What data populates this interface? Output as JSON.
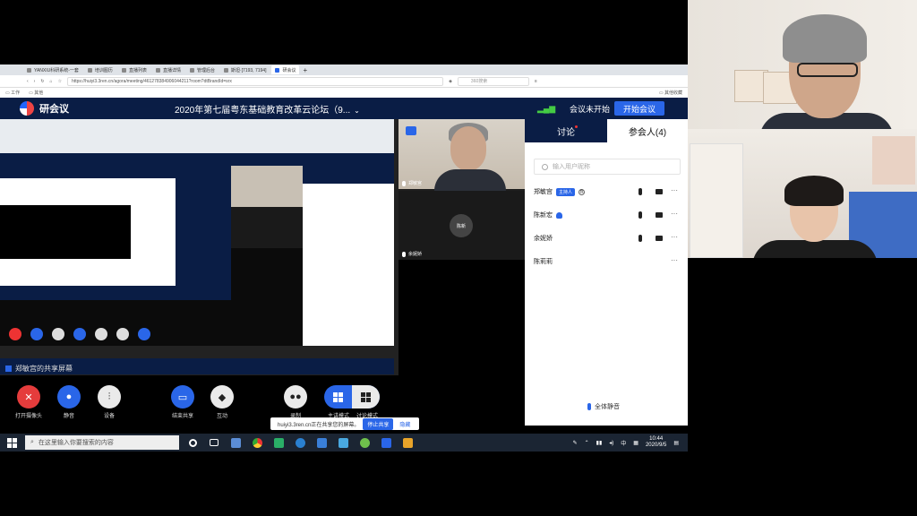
{
  "browser": {
    "brand": "百度",
    "tabs": [
      {
        "label": "YANXIU科研系统-一套"
      },
      {
        "label": "培训图历"
      },
      {
        "label": "直播列表"
      },
      {
        "label": "直播详情"
      },
      {
        "label": "管理后台"
      },
      {
        "label": "斯坦·[7193, 7194]"
      },
      {
        "label": "研会议"
      }
    ],
    "url": "https://huiyi3.3ren.cn/agora/meeting/461278384906044211?room?dtBrandId=srx",
    "search_placeholder": "360搜索",
    "bookmarks": [
      "工作",
      "其他"
    ],
    "bookmarks_right": "其他收藏"
  },
  "app": {
    "name": "研会议",
    "meeting_title": "2020年第七届粤东基础教育改革云论坛（9...",
    "status": "会议未开始",
    "start_button": "开始会议"
  },
  "videos": [
    {
      "name": "郑敏宫"
    },
    {
      "name": "余妮娇",
      "avatar": "陈新"
    }
  ],
  "panel": {
    "tab_chat": "讨论",
    "tab_people": "参会人(4)",
    "search_placeholder": "输入用户昵称",
    "participants": [
      {
        "name": "郑敏宫",
        "tag": "主持人",
        "badge": "我"
      },
      {
        "name": "陈新宏"
      },
      {
        "name": "余妮娇"
      },
      {
        "name": "陈莉莉"
      }
    ],
    "mute_all": "全体静音"
  },
  "sharing_label": "郑敏宫的共享屏幕",
  "controls": [
    {
      "label": "打开摄像头",
      "icon": "camera-off-icon"
    },
    {
      "label": "静音",
      "icon": "mic-icon"
    },
    {
      "label": "设备",
      "icon": "settings-icon"
    },
    {
      "label": "结束共享",
      "icon": "screen-share-icon"
    },
    {
      "label": "互动",
      "icon": "interact-icon"
    },
    {
      "label": "录制",
      "icon": "record-icon"
    }
  ],
  "layout_labels": [
    "主讲模式",
    "讨论模式"
  ],
  "toast": {
    "text": "huiyi3.3ren.cn正在共享您的屏幕。",
    "stop": "停止共享",
    "hide": "隐藏"
  },
  "taskbar": {
    "search_placeholder": "在这里输入你要搜索的内容",
    "ime": "中",
    "time": "10:44",
    "date": "2020/9/5"
  },
  "colors": {
    "app_header": "#0a1d45",
    "accent": "#2a66e8",
    "danger": "#e53c3c"
  }
}
